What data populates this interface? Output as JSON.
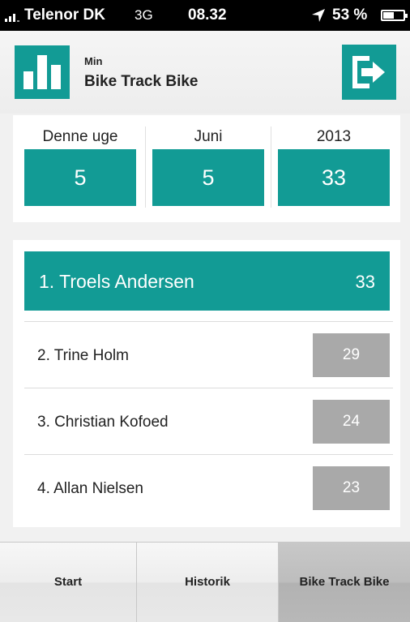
{
  "status_bar": {
    "carrier": "Telenor DK",
    "network": "3G",
    "time": "08.32",
    "battery": "53 %",
    "battery_level": 0.53
  },
  "header": {
    "subtitle": "Min",
    "title": "Bike Track Bike",
    "icons": {
      "logo": "bar-chart-icon",
      "logout": "logout-icon"
    }
  },
  "periods": [
    {
      "label": "Denne uge",
      "value": "5"
    },
    {
      "label": "Juni",
      "value": "5"
    },
    {
      "label": "2013",
      "value": "33"
    }
  ],
  "leaderboard": {
    "leader": {
      "name": "1. Troels Andersen",
      "score": "33"
    },
    "rows": [
      {
        "name": "2. Trine Holm",
        "score": "29"
      },
      {
        "name": "3. Christian Kofoed",
        "score": "24"
      },
      {
        "name": "4. Allan Nielsen",
        "score": "23"
      }
    ]
  },
  "tabs": [
    {
      "label": "Start"
    },
    {
      "label": "Historik"
    },
    {
      "label": "Bike Track Bike",
      "active": true
    }
  ],
  "colors": {
    "accent": "#129b95",
    "score_gray": "#a9a9a9"
  }
}
